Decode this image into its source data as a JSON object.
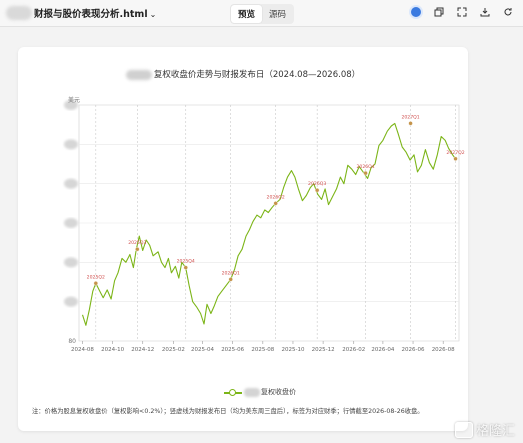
{
  "app": {
    "file_title": "财报与股价表现分析.html",
    "tabs": [
      {
        "label": "预览",
        "active": true
      },
      {
        "label": "源码",
        "active": false
      }
    ],
    "toolbar_icons": [
      "globe-icon",
      "copy-icon",
      "expand-icon",
      "download-icon",
      "reload-icon"
    ]
  },
  "chart_data": {
    "type": "line",
    "title": "复权收盘价走势与财报发布日（2024.08—2026.08）",
    "ylabel": "美元",
    "ylim": [
      80,
      260
    ],
    "y_ticks_visible": [
      "80"
    ],
    "x_ticks": [
      "2024-08",
      "2024-10",
      "2024-12",
      "2025-02",
      "2025-04",
      "2025-06",
      "2025-08",
      "2025-10",
      "2025-12",
      "2026-02",
      "2026-04",
      "2026-06",
      "2026-08"
    ],
    "series": [
      {
        "name": "复权收盘价",
        "color": "#7cb518"
      }
    ],
    "points": [
      [
        "2024-08-01",
        100
      ],
      [
        "2024-08-08",
        92
      ],
      [
        "2024-08-15",
        104
      ],
      [
        "2024-08-22",
        118
      ],
      [
        "2024-08-28",
        124
      ],
      [
        "2024-09-05",
        118
      ],
      [
        "2024-09-12",
        113
      ],
      [
        "2024-09-20",
        119
      ],
      [
        "2024-09-28",
        112
      ],
      [
        "2024-10-05",
        126
      ],
      [
        "2024-10-12",
        132
      ],
      [
        "2024-10-20",
        143
      ],
      [
        "2024-10-28",
        140
      ],
      [
        "2024-11-05",
        146
      ],
      [
        "2024-11-12",
        136
      ],
      [
        "2024-11-18",
        150
      ],
      [
        "2024-11-24",
        160
      ],
      [
        "2024-12-01",
        149
      ],
      [
        "2024-12-08",
        157
      ],
      [
        "2024-12-15",
        153
      ],
      [
        "2024-12-22",
        145
      ],
      [
        "2025-01-01",
        148
      ],
      [
        "2025-01-08",
        140
      ],
      [
        "2025-01-15",
        136
      ],
      [
        "2025-01-22",
        143
      ],
      [
        "2025-01-28",
        132
      ],
      [
        "2025-02-05",
        137
      ],
      [
        "2025-02-12",
        128
      ],
      [
        "2025-02-18",
        140
      ],
      [
        "2025-02-26",
        136
      ],
      [
        "2025-03-05",
        122
      ],
      [
        "2025-03-12",
        110
      ],
      [
        "2025-03-20",
        106
      ],
      [
        "2025-03-28",
        101
      ],
      [
        "2025-04-04",
        93
      ],
      [
        "2025-04-10",
        108
      ],
      [
        "2025-04-18",
        101
      ],
      [
        "2025-04-25",
        107
      ],
      [
        "2025-05-02",
        114
      ],
      [
        "2025-05-10",
        118
      ],
      [
        "2025-05-18",
        122
      ],
      [
        "2025-05-28",
        127
      ],
      [
        "2025-06-05",
        135
      ],
      [
        "2025-06-12",
        145
      ],
      [
        "2025-06-20",
        150
      ],
      [
        "2025-06-28",
        160
      ],
      [
        "2025-07-05",
        165
      ],
      [
        "2025-07-12",
        171
      ],
      [
        "2025-07-20",
        176
      ],
      [
        "2025-07-28",
        174
      ],
      [
        "2025-08-05",
        180
      ],
      [
        "2025-08-12",
        178
      ],
      [
        "2025-08-20",
        182
      ],
      [
        "2025-08-27",
        185
      ],
      [
        "2025-09-05",
        188
      ],
      [
        "2025-09-12",
        197
      ],
      [
        "2025-09-20",
        205
      ],
      [
        "2025-09-28",
        210
      ],
      [
        "2025-10-05",
        205
      ],
      [
        "2025-10-12",
        196
      ],
      [
        "2025-10-20",
        187
      ],
      [
        "2025-10-28",
        191
      ],
      [
        "2025-11-05",
        197
      ],
      [
        "2025-11-12",
        200
      ],
      [
        "2025-11-20",
        192
      ],
      [
        "2025-11-28",
        188
      ],
      [
        "2025-12-05",
        196
      ],
      [
        "2025-12-12",
        184
      ],
      [
        "2025-12-20",
        190
      ],
      [
        "2025-12-28",
        196
      ],
      [
        "2026-01-05",
        205
      ],
      [
        "2026-01-12",
        200
      ],
      [
        "2026-01-20",
        214
      ],
      [
        "2026-01-28",
        211
      ],
      [
        "2026-02-05",
        207
      ],
      [
        "2026-02-12",
        213
      ],
      [
        "2026-02-20",
        209
      ],
      [
        "2026-03-01",
        204
      ],
      [
        "2026-03-08",
        212
      ],
      [
        "2026-03-16",
        215
      ],
      [
        "2026-03-24",
        229
      ],
      [
        "2026-04-01",
        233
      ],
      [
        "2026-04-10",
        240
      ],
      [
        "2026-04-18",
        244
      ],
      [
        "2026-04-25",
        246
      ],
      [
        "2026-05-02",
        238
      ],
      [
        "2026-05-10",
        228
      ],
      [
        "2026-05-18",
        224
      ],
      [
        "2026-05-26",
        218
      ],
      [
        "2026-06-03",
        222
      ],
      [
        "2026-06-10",
        209
      ],
      [
        "2026-06-18",
        214
      ],
      [
        "2026-06-26",
        226
      ],
      [
        "2026-07-04",
        216
      ],
      [
        "2026-07-12",
        211
      ],
      [
        "2026-07-20",
        222
      ],
      [
        "2026-07-28",
        236
      ],
      [
        "2026-08-05",
        233
      ],
      [
        "2026-08-12",
        227
      ],
      [
        "2026-08-20",
        222
      ],
      [
        "2026-08-26",
        219
      ]
    ],
    "earnings": [
      {
        "date": "2024-08-28",
        "label": "2025Q2",
        "value": 124
      },
      {
        "date": "2024-11-20",
        "label": "2025Q3",
        "value": 150
      },
      {
        "date": "2025-02-26",
        "label": "2025Q4",
        "value": 136
      },
      {
        "date": "2025-05-28",
        "label": "2026Q1",
        "value": 127
      },
      {
        "date": "2025-08-27",
        "label": "2026Q2",
        "value": 185
      },
      {
        "date": "2025-11-19",
        "label": "2026Q3",
        "value": 195
      },
      {
        "date": "2026-02-25",
        "label": "2026Q4",
        "value": 208
      },
      {
        "date": "2026-05-27",
        "label": "2027Q1",
        "value": 246
      },
      {
        "date": "2026-08-26",
        "label": "2027Q2",
        "value": 219
      }
    ]
  },
  "legend": {
    "label": "复权收盘价"
  },
  "note": "注：价格为股息复权收盘价（复权影响<0.2%）；竖虚线为财报发布日（均为美东周三盘后），标签为对应财季；行情截至2026-08-26收盘。",
  "watermark": "格隆汇"
}
